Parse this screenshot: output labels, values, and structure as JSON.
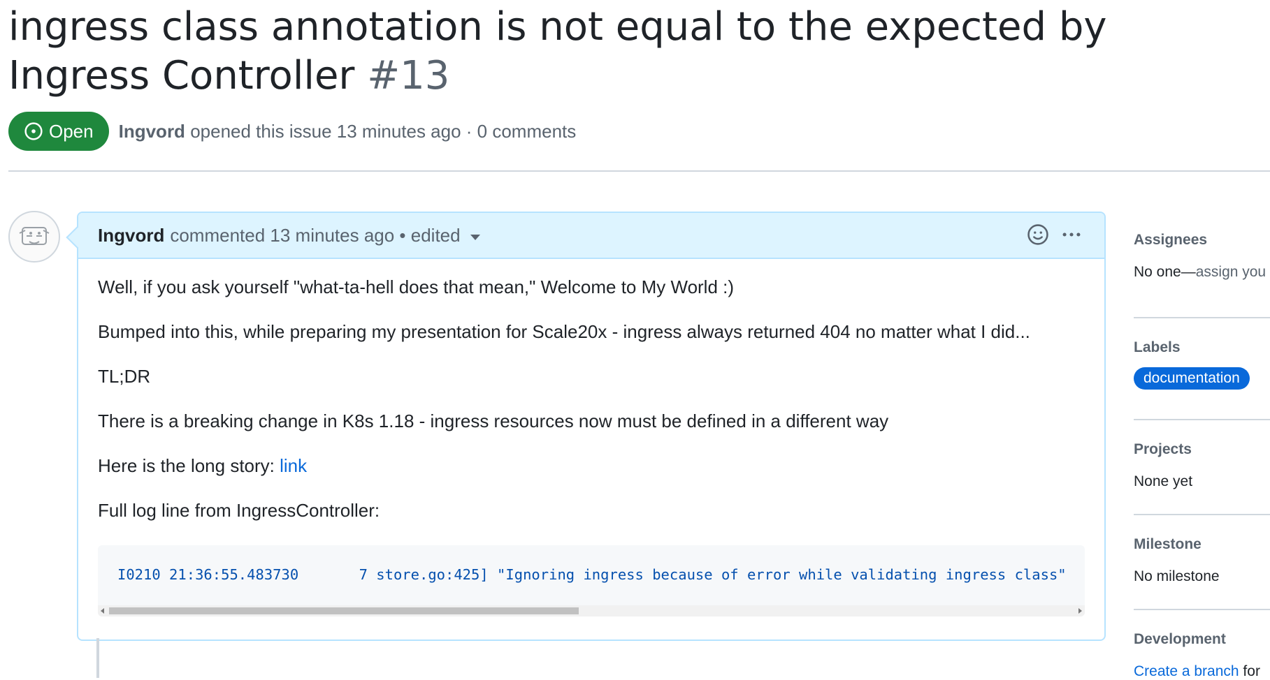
{
  "issue": {
    "title": "ingress class annotation is not equal to the expected by Ingress Controller",
    "number": "#13",
    "state": "Open",
    "author": "Ingvord",
    "opened_text": "opened this issue 13 minutes ago · 0 comments"
  },
  "comment": {
    "author": "Ingvord",
    "meta": "commented 13 minutes ago • edited",
    "paragraphs": [
      "Well, if you ask yourself \"what-ta-hell does that mean,\" Welcome to My World :)",
      "Bumped into this, while preparing my presentation for Scale20x - ingress always returned 404 no matter what I did...",
      "TL;DR",
      "There is a breaking change in K8s 1.18 - ingress resources now must be defined in a different way"
    ],
    "story_prefix": "Here is the long story: ",
    "story_link": "link",
    "log_intro": "Full log line from IngressController:",
    "code": "I0210 21:36:55.483730       7 store.go:425] \"Ignoring ingress because of error while validating ingress class\""
  },
  "sidebar": {
    "assignees_head": "Assignees",
    "assignees_val_prefix": "No one—",
    "assignees_val_link": "assign you",
    "labels_head": "Labels",
    "label": "documentation",
    "projects_head": "Projects",
    "projects_val": "None yet",
    "milestone_head": "Milestone",
    "milestone_val": "No milestone",
    "development_head": "Development",
    "development_link": "Create a branch",
    "development_suffix": " for"
  },
  "colors": {
    "open_green": "#1f883d",
    "link_blue": "#0969da",
    "header_blue": "#ddf4ff"
  }
}
